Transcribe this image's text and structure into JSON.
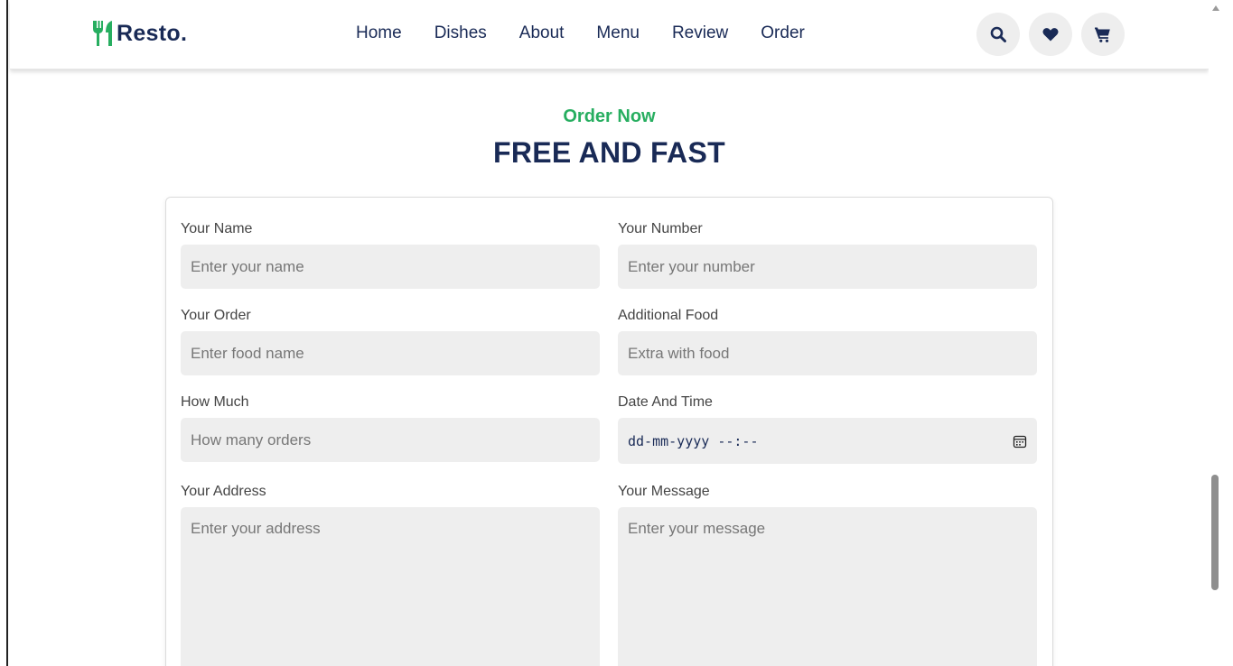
{
  "brand": {
    "name": "Resto.",
    "accent": "#27ae60",
    "primary": "#192a56"
  },
  "nav": {
    "items": [
      "Home",
      "Dishes",
      "About",
      "Menu",
      "Review",
      "Order"
    ]
  },
  "header_icons": [
    "search-icon",
    "heart-icon",
    "cart-icon"
  ],
  "section": {
    "sub_heading": "Order Now",
    "heading": "FREE AND FAST"
  },
  "form": {
    "name": {
      "label": "Your Name",
      "placeholder": "Enter your name"
    },
    "number": {
      "label": "Your Number",
      "placeholder": "Enter your number"
    },
    "order": {
      "label": "Your Order",
      "placeholder": "Enter food name"
    },
    "additional": {
      "label": "Additional Food",
      "placeholder": "Extra with food"
    },
    "quantity": {
      "label": "How Much",
      "placeholder": "How many orders"
    },
    "datetime": {
      "label": "Date And Time",
      "value": "dd-mm-yyyy --:--"
    },
    "address": {
      "label": "Your Address",
      "placeholder": "Enter your address"
    },
    "message": {
      "label": "Your Message",
      "placeholder": "Enter your message"
    }
  }
}
